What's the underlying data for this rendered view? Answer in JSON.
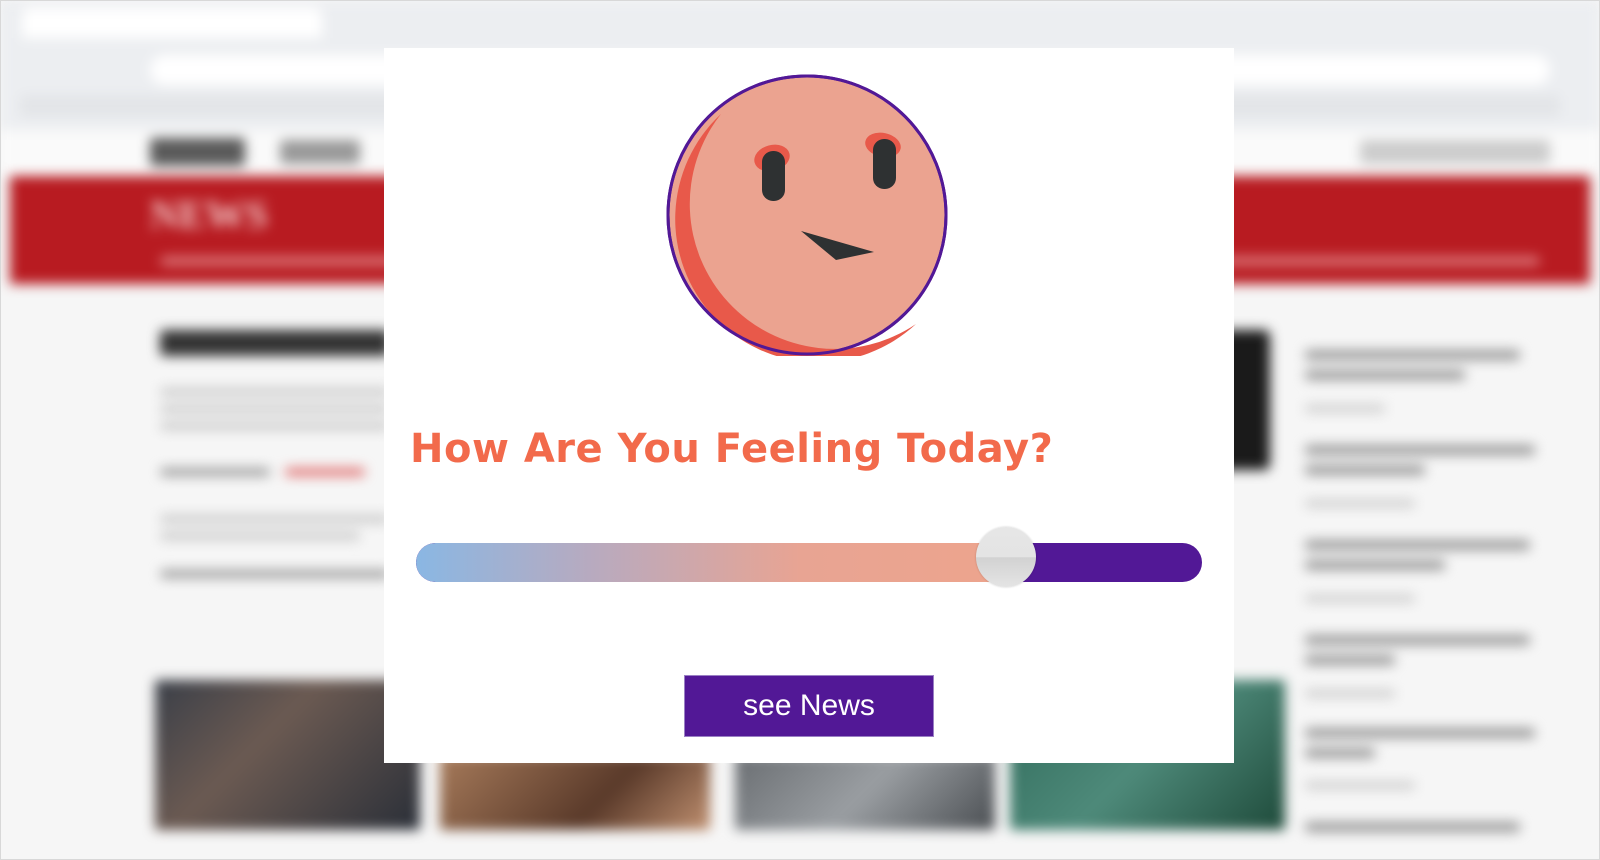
{
  "background": {
    "site_logo": "NEWS"
  },
  "modal": {
    "title": "How Are You Feeling Today?",
    "mood_slider": {
      "value_fraction": 0.75
    },
    "cta_label": "see News"
  },
  "colors": {
    "brand_purple": "#521896",
    "title_orange": "#f26a4b",
    "face_fill": "#eba390",
    "face_shade": "#e8594a",
    "site_red": "#b81b21"
  },
  "icons": {
    "mood_face": "mood-face-icon"
  }
}
